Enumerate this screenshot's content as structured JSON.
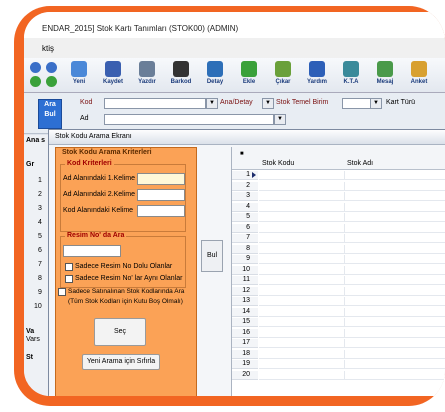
{
  "window": {
    "title": "ENDAR_2015] Stok Kartı Tanımları (STOK00) (ADMIN)",
    "menu_item": "ktiş"
  },
  "toolbar": {
    "buttons": [
      {
        "label": "Yeni",
        "icon": "new-document-icon",
        "color": "#4a88d8"
      },
      {
        "label": "Kaydet",
        "icon": "save-icon",
        "color": "#3a5fb0"
      },
      {
        "label": "Yazdır",
        "icon": "printer-icon",
        "color": "#6a7e98"
      },
      {
        "label": "Barkod",
        "icon": "barcode-icon",
        "color": "#333333"
      },
      {
        "label": "Detay",
        "icon": "magnifier-icon",
        "color": "#2d6fb8"
      },
      {
        "label": "Ekle",
        "icon": "add-icon",
        "color": "#3aa13a"
      },
      {
        "label": "Çıkar",
        "icon": "remove-icon",
        "color": "#6aa03a"
      },
      {
        "label": "Yardım",
        "icon": "help-icon",
        "color": "#2d5fb8"
      },
      {
        "label": "K.T.A",
        "icon": "kta-icon",
        "color": "#3a8a9a"
      },
      {
        "label": "Mesaj",
        "icon": "message-icon",
        "color": "#4a9a4a"
      },
      {
        "label": "Anket",
        "icon": "survey-icon",
        "color": "#d8a030"
      }
    ]
  },
  "filter": {
    "search_button": "Ara Bul",
    "kod_label": "Kod",
    "ad_label": "Ad",
    "ana_detay_label": "Ana/Detay",
    "stok_temel_birim_label": "Stok Temel Birim",
    "kart_turu_label": "Kart Türü"
  },
  "left_strip": {
    "tab_label": "Ana s",
    "group_label": "Gr",
    "row_numbers": [
      "1",
      "2",
      "3",
      "4",
      "5",
      "6",
      "7",
      "8",
      "9",
      "10"
    ],
    "va_label": "Va",
    "vars_label": "Vars",
    "st_label": "St"
  },
  "dialog": {
    "title": "Stok Kodu Arama Ekranı",
    "criteria_group": "Stok Kodu Arama Kriterleri",
    "kod_kriterleri_title": "Kod Kriterleri",
    "kelime1_label": "Ad Alanındaki 1.Kelime",
    "kelime2_label": "Ad Alanındaki 2.Kelime",
    "kod_kelime_label": "Kod Alanındaki Kelime",
    "resim_title": "Resim No' da Ara",
    "resim_dolu_label": "Sadece Resim No Dolu Olanlar",
    "resim_ayni_label": "Sadece Resim No' lar Aynı Olanlar",
    "satinalinan_label": "Sadece Satınalınan Stok Kodlarında Ara",
    "satinalinan_note": "(Tüm Stok Kodları için Kutu Boş Olmalı)",
    "sec_button": "Seç",
    "yeni_arama_button": "Yeni Arama için Sıfırla",
    "bul_button": "Bul"
  },
  "grid": {
    "columns": [
      "Stok Kodu",
      "Stok Adı"
    ],
    "row_numbers": [
      "1",
      "2",
      "3",
      "4",
      "5",
      "6",
      "7",
      "8",
      "9",
      "10",
      "11",
      "12",
      "13",
      "14",
      "15",
      "16",
      "17",
      "18",
      "19",
      "20"
    ],
    "selected_row": 1
  },
  "colors": {
    "frame_accent": "#f26522",
    "dialog_panel": "#fba256",
    "group_title": "#a00000",
    "search_button": "#2d6fd3"
  }
}
